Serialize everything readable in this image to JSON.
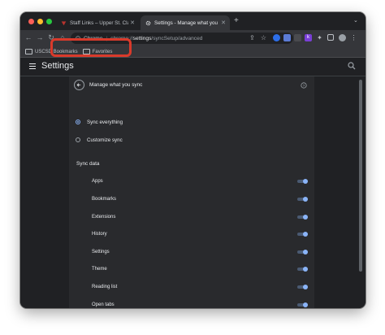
{
  "tabs": [
    {
      "title": "Staff Links – Upper St. Clair S",
      "active": false,
      "favicon": "upper-st-clair-logo"
    },
    {
      "title": "Settings - Manage what you s",
      "active": true,
      "favicon": "gear-icon"
    }
  ],
  "omnibox": {
    "chrome_label": "Chrome",
    "url_prefix": "chrome://",
    "url_host": "settings",
    "url_path": "/syncSetup/advanced"
  },
  "bookmarks": [
    "USCSD Bookmarks",
    "Favorites"
  ],
  "settings": {
    "title": "Settings"
  },
  "sync_page": {
    "title": "Manage what you sync",
    "options": [
      {
        "label": "Sync everything",
        "selected": true
      },
      {
        "label": "Customize sync",
        "selected": false
      }
    ],
    "section_label": "Sync data",
    "items": [
      {
        "label": "Apps",
        "on": true
      },
      {
        "label": "Bookmarks",
        "on": true
      },
      {
        "label": "Extensions",
        "on": true
      },
      {
        "label": "History",
        "on": true
      },
      {
        "label": "Settings",
        "on": true
      },
      {
        "label": "Theme",
        "on": true
      },
      {
        "label": "Reading list",
        "on": true
      },
      {
        "label": "Open tabs",
        "on": true
      }
    ]
  },
  "colors": {
    "accent": "#8ab4f8",
    "highlight": "#d93a2b",
    "background": "#202124",
    "card": "#292a2d"
  }
}
